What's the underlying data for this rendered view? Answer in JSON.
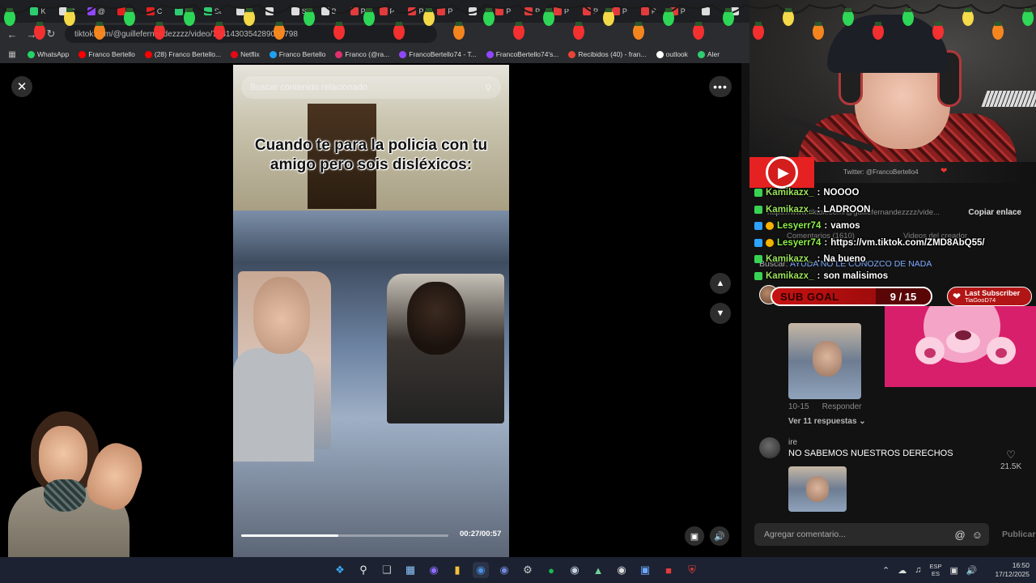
{
  "browser": {
    "url": "tiktok.com/@guillefernandezzzz/video/7581430354289003798",
    "tabs": [
      "K",
      "C",
      "@",
      "C",
      "C",
      "Fr",
      "St",
      "",
      "",
      "Si",
      "B",
      "P",
      "P",
      "P",
      "P",
      "",
      "P",
      "P",
      "P",
      "P",
      "P",
      "P",
      "P",
      "",
      ""
    ],
    "bookmarks": [
      {
        "label": "WhatsApp",
        "color": "#25d366"
      },
      {
        "label": "Franco Bertello",
        "color": "#ff0000"
      },
      {
        "label": "(28) Franco Bertello...",
        "color": "#ff0000"
      },
      {
        "label": "Netflix",
        "color": "#e50914"
      },
      {
        "label": "Franco Bertello",
        "color": "#1da1f2"
      },
      {
        "label": "Franco (@ra...",
        "color": "#e1306c"
      },
      {
        "label": "FrancoBertello74 - T...",
        "color": "#9146ff"
      },
      {
        "label": "FrancoBertello74's...",
        "color": "#9146ff"
      },
      {
        "label": "Recibidos (40) - fran...",
        "color": "#ea4335"
      },
      {
        "label": "outlook",
        "color": "#ffffff"
      },
      {
        "label": "Aler",
        "color": "#2ecc71"
      }
    ]
  },
  "viewer": {
    "search_placeholder": "Buscar contenido relacionado",
    "caption": "Cuando te para la policia con tu amigo pero sois disléxicos:",
    "time": "00:27/00:57",
    "progress": 0.47
  },
  "comments": {
    "copy_link_url": "https://www.tiktok.com/@guillefernandezzzz/vide...",
    "copy_link_label": "Copiar enlace",
    "tab_comments": "Comentarios (1610)",
    "tab_videos": "Videos del creador",
    "search_label": "Buscar:",
    "search_term": "AYUDA NO LE CONOZCO DE NADA",
    "first_meta": {
      "date": "10-15",
      "reply": "Responder",
      "more": "Ver 11 respuestas"
    },
    "second": {
      "user": "ire",
      "text": "NO SABEMOS NUESTROS DERECHOS",
      "likes": "21.5K"
    },
    "input_placeholder": "Agregar comentario...",
    "publish": "Publicar"
  },
  "stream": {
    "twitter": "Twitter: @FrancoBertello4",
    "chat": [
      {
        "user": "Kamikazx_",
        "msg": "NOOOO",
        "user_color": "#9be35a",
        "badge": "#39d353",
        "sub": false
      },
      {
        "user": "Kamikazx_",
        "msg": "LADROON",
        "user_color": "#9be35a",
        "badge": "#39d353",
        "sub": false
      },
      {
        "user": "Lesyerr74",
        "msg": "vamos",
        "user_color": "#8ef04b",
        "badge": "#2ea3ff",
        "sub": true
      },
      {
        "user": "Lesyerr74",
        "msg": "https://vm.tiktok.com/ZMD8AbQ55/",
        "user_color": "#8ef04b",
        "badge": "#2ea3ff",
        "sub": true
      },
      {
        "user": "Kamikazx_",
        "msg": "Na bueno",
        "user_color": "#9be35a",
        "badge": "#39d353",
        "sub": false
      },
      {
        "user": "Kamikazx_",
        "msg": "son malisimos",
        "user_color": "#9be35a",
        "badge": "#39d353",
        "sub": false
      }
    ],
    "sub_goal_label": "SUB GOAL",
    "sub_goal_count": "9 / 15",
    "last_sub_label": "Last Subscriber",
    "last_sub_name": "TiaGooD74"
  },
  "taskbar": {
    "lang": "ESP",
    "lang_sub": "ES",
    "time": "16:50",
    "date": "17/12/2025"
  }
}
